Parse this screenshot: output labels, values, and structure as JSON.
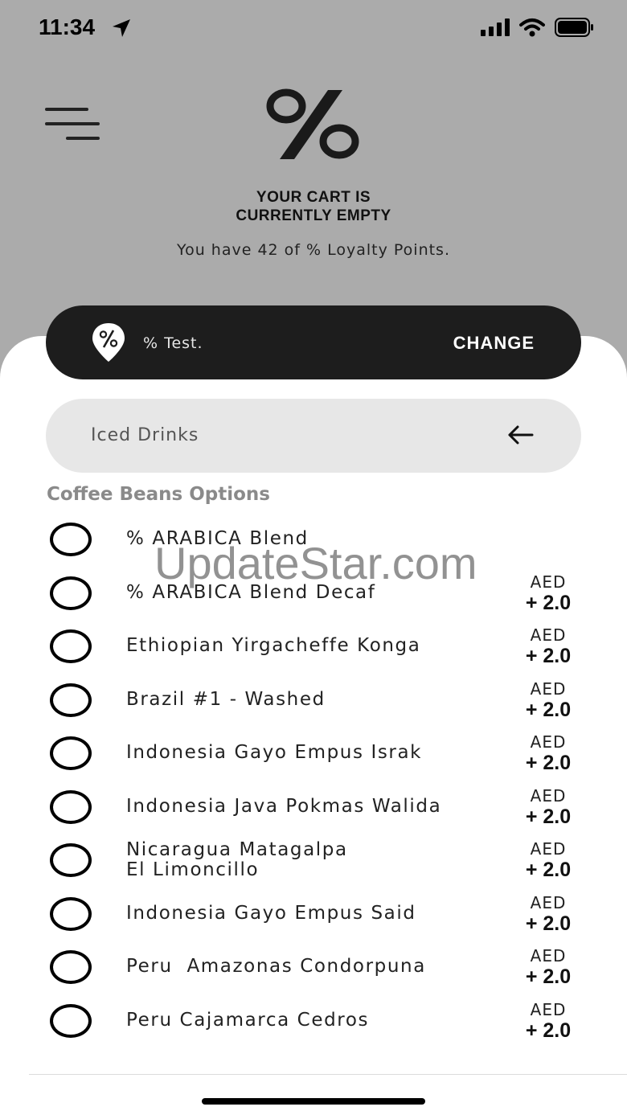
{
  "status_bar": {
    "time": "11:34"
  },
  "header": {
    "cart_line1": "YOUR CART IS",
    "cart_line2": "CURRENTLY EMPTY",
    "loyalty_text": "You have 42 of % Loyalty Points."
  },
  "store": {
    "name": "% Test.",
    "change_label": "CHANGE"
  },
  "category": {
    "label": "Iced Drinks"
  },
  "section": {
    "title": "Coffee Beans Options"
  },
  "watermark": "UpdateStar.com",
  "options": [
    {
      "name": "% ARABICA Blend",
      "currency": "",
      "price": ""
    },
    {
      "name": "% ARABICA Blend Decaf",
      "currency": "AED",
      "price": "+ 2.0"
    },
    {
      "name": "Ethiopian Yirgacheffe Konga",
      "currency": "AED",
      "price": "+ 2.0"
    },
    {
      "name": "Brazil #1 - Washed",
      "currency": "AED",
      "price": "+ 2.0"
    },
    {
      "name": "Indonesia Gayo Empus Israk",
      "currency": "AED",
      "price": "+ 2.0"
    },
    {
      "name": "Indonesia Java Pokmas Walida",
      "currency": "AED",
      "price": "+ 2.0"
    },
    {
      "name_line1": "Nicaragua Matagalpa",
      "name_line2": "El Limoncillo",
      "currency": "AED",
      "price": "+ 2.0"
    },
    {
      "name": "Indonesia Gayo Empus Said",
      "currency": "AED",
      "price": "+ 2.0"
    },
    {
      "name": "Peru  Amazonas Condorpuna",
      "currency": "AED",
      "price": "+ 2.0"
    },
    {
      "name": "Peru Cajamarca Cedros",
      "currency": "AED",
      "price": "+ 2.0"
    }
  ],
  "colors": {
    "background": "#ababab",
    "store_bar": "#1d1d1d",
    "category_bar": "#e7e7e7",
    "section_title": "#8a8a8a"
  }
}
